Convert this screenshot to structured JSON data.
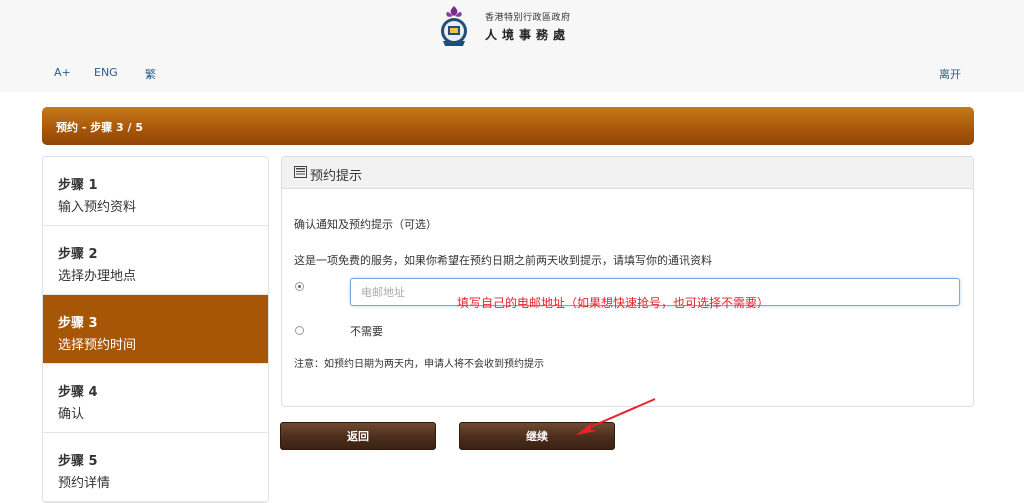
{
  "header": {
    "dept_line1": "香港特別行政區政府",
    "dept_line2": "人境事務處",
    "logo_icon": "hk-immigration-emblem-icon"
  },
  "toolbar": {
    "font_size": "A+",
    "eng": "ENG",
    "traditional": "繁",
    "exit": "离开"
  },
  "banner": {
    "title": "预约 - 步骤 3 / 5"
  },
  "sidebar": {
    "items": [
      {
        "num": "步骤 1",
        "label": "输入预约资料",
        "active": false
      },
      {
        "num": "步骤 2",
        "label": "选择办理地点",
        "active": false
      },
      {
        "num": "步骤 3",
        "label": "选择预约时间",
        "active": true
      },
      {
        "num": "步骤 4",
        "label": "确认",
        "active": false
      },
      {
        "num": "步骤 5",
        "label": "预约详情",
        "active": false
      }
    ]
  },
  "panel": {
    "title": "预约提示",
    "title_icon": "document-icon",
    "line1": "确认通知及预约提示（可选）",
    "line2": "这是一项免费的服务，如果你希望在预约日期之前两天收到提示，请填写你的通讯资料",
    "email_placeholder": "电邮地址",
    "annotation": "填写自己的电邮地址（如果想快速抢号，也可选择不需要）",
    "no_need": "不需要",
    "note": "注意：如预约日期为两天内，申请人将不会收到预约提示"
  },
  "buttons": {
    "back": "返回",
    "next": "继续"
  },
  "colors": {
    "accent": "#a75608",
    "button": "#4b2d1b",
    "annotation": "#e8242a"
  }
}
